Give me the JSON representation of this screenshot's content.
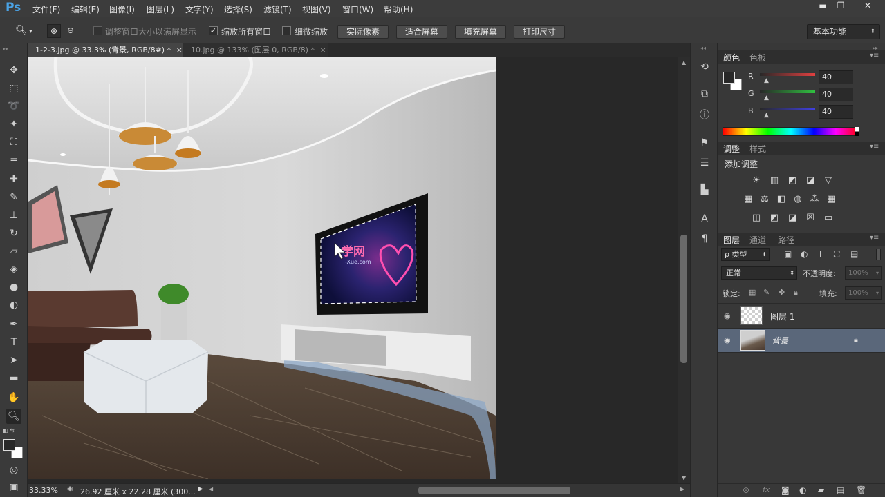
{
  "app": {
    "logo": "Ps",
    "accent": "#4aa3e6"
  },
  "menu": [
    "文件(F)",
    "编辑(E)",
    "图像(I)",
    "图层(L)",
    "文字(Y)",
    "选择(S)",
    "滤镜(T)",
    "视图(V)",
    "窗口(W)",
    "帮助(H)"
  ],
  "window_controls": {
    "minimize": "▬",
    "restore": "❐",
    "close": "✕"
  },
  "options": {
    "resize_windows": "调整窗口大小以满屏显示",
    "zoom_all": "缩放所有窗口",
    "scrubby_zoom": "细微缩放",
    "actual_pixels": "实际像素",
    "fit_screen": "适合屏幕",
    "fill_screen": "填充屏幕",
    "print_size": "打印尺寸",
    "workspace": "基本功能"
  },
  "tabs": [
    {
      "label": "1-2-3.jpg @ 33.3% (背景, RGB/8#) *",
      "close": "×"
    },
    {
      "label": "10.jpg @ 133% (图层 0, RGB/8) *",
      "close": "×"
    }
  ],
  "status": {
    "zoom": "33.33%",
    "doc_size": "26.92 厘米 x 22.28 厘米 (300..."
  },
  "panels": {
    "color_tabs": [
      "颜色",
      "色板"
    ],
    "color_channels": [
      {
        "label": "R",
        "value": "40",
        "color": "#e04040"
      },
      {
        "label": "G",
        "value": "40",
        "color": "#30c040"
      },
      {
        "label": "B",
        "value": "40",
        "color": "#4040e0"
      }
    ],
    "adjust_tabs": [
      "调整",
      "样式"
    ],
    "add_adjustment": "添加调整",
    "layer_tabs": [
      "图层",
      "通道",
      "路径"
    ],
    "filter_kind": "ρ 类型",
    "blend_mode": "正常",
    "opacity_label": "不透明度:",
    "opacity_value": "100%",
    "lock_label": "锁定:",
    "fill_label": "填充:",
    "fill_value": "100%",
    "layers": [
      {
        "name": "图层 1",
        "selected": false
      },
      {
        "name": "背景",
        "selected": true
      }
    ]
  },
  "canvas_logo": {
    "title": "学网",
    "sub": "-Xue.com"
  }
}
